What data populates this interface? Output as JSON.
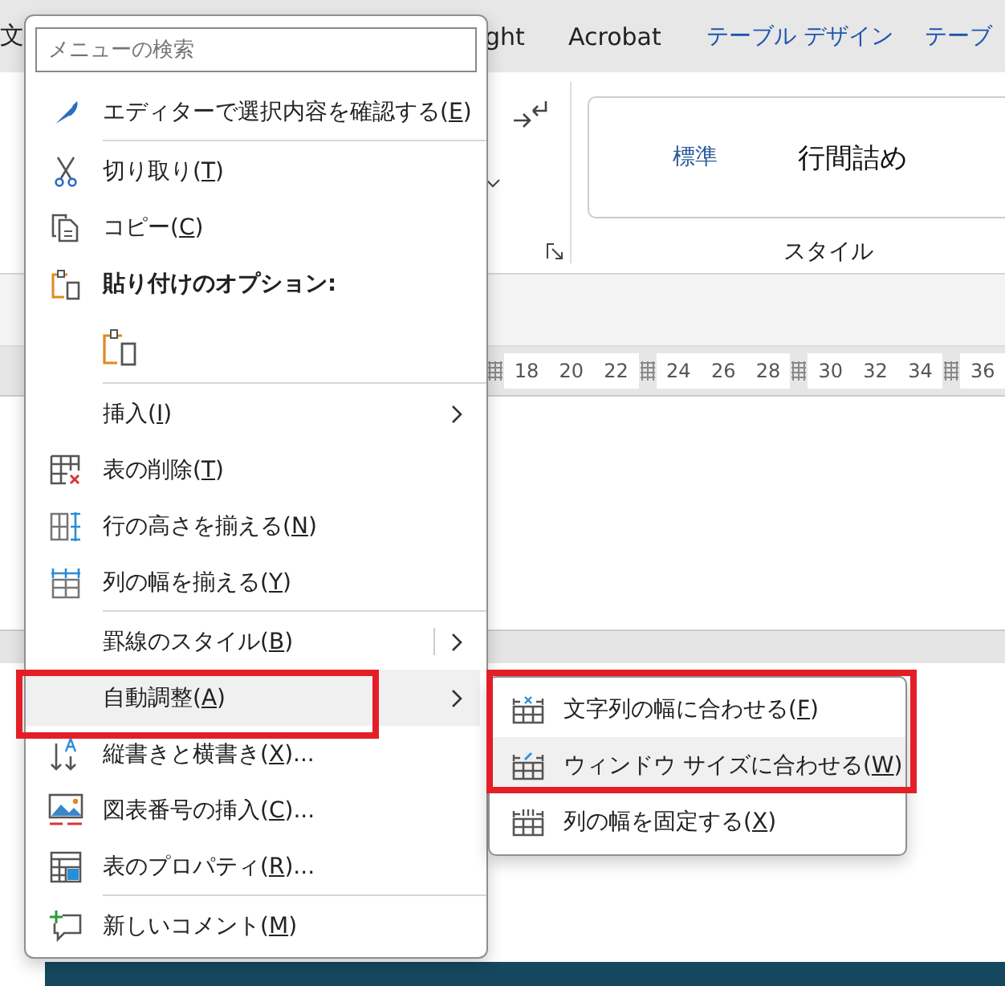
{
  "ribbon": {
    "tabs": [
      {
        "label": "文",
        "contextual": false
      },
      {
        "label": "ght",
        "contextual": false
      },
      {
        "label": "Acrobat",
        "contextual": false
      },
      {
        "label": "テーブル デザイン",
        "contextual": true
      },
      {
        "label": "テーブ",
        "contextual": true
      }
    ],
    "styles": [
      {
        "label": "標準",
        "current": true
      },
      {
        "label": "行間詰め",
        "current": false
      }
    ],
    "group_label": "スタイル",
    "ruler": [
      {
        "kind": "marker"
      },
      {
        "kind": "number",
        "text": "18"
      },
      {
        "kind": "number",
        "text": "20"
      },
      {
        "kind": "number",
        "text": "22"
      },
      {
        "kind": "marker"
      },
      {
        "kind": "number",
        "text": "24"
      },
      {
        "kind": "number",
        "text": "26"
      },
      {
        "kind": "number",
        "text": "28"
      },
      {
        "kind": "marker"
      },
      {
        "kind": "number",
        "text": "30"
      },
      {
        "kind": "number",
        "text": "32"
      },
      {
        "kind": "number",
        "text": "34"
      },
      {
        "kind": "marker"
      },
      {
        "kind": "number",
        "text": "36"
      }
    ]
  },
  "context_menu": {
    "search": {
      "placeholder": "メニューの検索"
    },
    "items": [
      {
        "kind": "command",
        "text": "エディターで選択内容を確認する(",
        "key": "E",
        "after": ")",
        "submenu": false,
        "split": false,
        "selected": false
      },
      {
        "kind": "separator"
      },
      {
        "kind": "command",
        "text": "切り取り(",
        "key": "T",
        "after": ")",
        "submenu": false,
        "split": false,
        "selected": false
      },
      {
        "kind": "command",
        "text": "コピー(",
        "key": "C",
        "after": ")",
        "submenu": false,
        "split": false,
        "selected": false
      },
      {
        "kind": "header",
        "text": "貼り付けのオプション:"
      },
      {
        "kind": "paste-options"
      },
      {
        "kind": "separator"
      },
      {
        "kind": "command",
        "text": "挿入(",
        "key": "I",
        "after": ")",
        "submenu": true,
        "split": false,
        "selected": false
      },
      {
        "kind": "command",
        "text": "表の削除(",
        "key": "T",
        "after": ")",
        "submenu": false,
        "split": false,
        "selected": false
      },
      {
        "kind": "command",
        "text": "行の高さを揃える(",
        "key": "N",
        "after": ")",
        "submenu": false,
        "split": false,
        "selected": false
      },
      {
        "kind": "command",
        "text": "列の幅を揃える(",
        "key": "Y",
        "after": ")",
        "submenu": false,
        "split": false,
        "selected": false
      },
      {
        "kind": "separator"
      },
      {
        "kind": "command",
        "text": "罫線のスタイル(",
        "key": "B",
        "after": ")",
        "submenu": true,
        "split": true,
        "selected": false
      },
      {
        "kind": "command",
        "text": "自動調整(",
        "key": "A",
        "after": ")",
        "submenu": true,
        "split": false,
        "selected": true
      },
      {
        "kind": "command",
        "text": "縦書きと横書き(",
        "key": "X",
        "after": ")...",
        "submenu": false,
        "split": false,
        "selected": false
      },
      {
        "kind": "command",
        "text": "図表番号の挿入(",
        "key": "C",
        "after": ")...",
        "submenu": false,
        "split": false,
        "selected": false
      },
      {
        "kind": "command",
        "text": "表のプロパティ(",
        "key": "R",
        "after": ")...",
        "submenu": false,
        "split": false,
        "selected": false
      },
      {
        "kind": "separator"
      },
      {
        "kind": "command",
        "text": "新しいコメント(",
        "key": "M",
        "after": ")",
        "submenu": false,
        "split": false,
        "selected": false
      }
    ]
  },
  "submenu": {
    "items": [
      {
        "text": "文字列の幅に合わせる(",
        "key": "F",
        "after": ")",
        "selected": false
      },
      {
        "text": "ウィンドウ サイズに合わせる(",
        "key": "W",
        "after": ")",
        "selected": true
      },
      {
        "text": "列の幅を固定する(",
        "key": "X",
        "after": ")",
        "selected": false
      }
    ]
  }
}
